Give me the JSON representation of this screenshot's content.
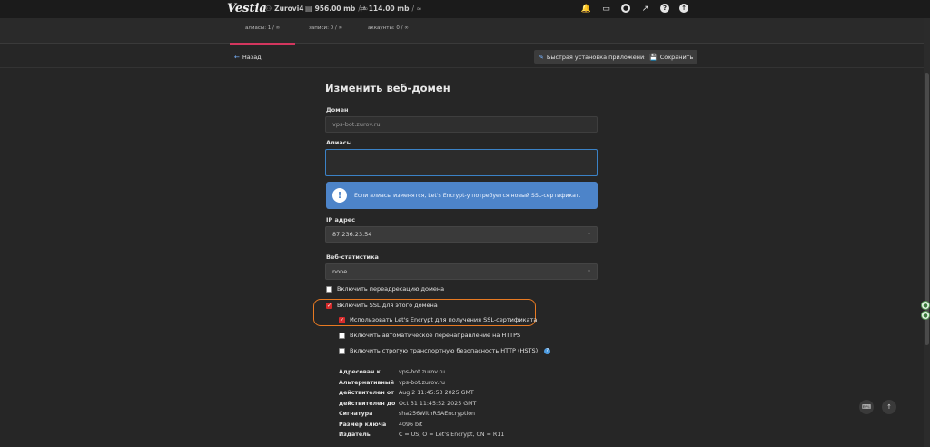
{
  "topbar": {
    "logo": "Vestia",
    "user": "Zurovi4",
    "disk": "956.00 mb",
    "disk_limit": "/ ∞",
    "bandwidth": "114.00 mb",
    "bandwidth_limit": "/ ∞"
  },
  "strip": {
    "aliases": "алиасы: 1 / ∞",
    "records": "записи: 0 / ∞",
    "accounts": "аккаунты: 0 / ∞"
  },
  "toolbar": {
    "back": "Назад",
    "quick_install": "Быстрая установка приложения",
    "save": "Сохранить"
  },
  "form": {
    "title": "Изменить веб-домен",
    "domain_label": "Домен",
    "domain_value": "vps-bot.zurov.ru",
    "aliases_label": "Алиасы",
    "alert": "Если алиасы изменятся, Let's Encrypt-у потребуется новый SSL-сертификат.",
    "ip_label": "IP адрес",
    "ip_value": "87.236.23.54",
    "stats_label": "Веб-статистика",
    "stats_value": "none",
    "redirect_label": "Включить переадресацию домена",
    "ssl_label": "Включить SSL для этого домена",
    "letsencrypt_label": "Использовать Let's Encrypt для получения SSL-сертификата",
    "https_label": "Включить автоматическое перенаправление на HTTPS",
    "hsts_label": "Включить строгую транспортную безопасность HTTP (HSTS)"
  },
  "cert": {
    "rows": [
      {
        "k": "Адресован к",
        "v": "vps-bot.zurov.ru"
      },
      {
        "k": "Альтернативный",
        "v": "vps-bot.zurov.ru"
      },
      {
        "k": "действителен от",
        "v": "Aug 2 11:45:53 2025 GMT"
      },
      {
        "k": "действителен до",
        "v": "Oct 31 11:45:52 2025 GMT"
      },
      {
        "k": "Сигнатура",
        "v": "sha256WithRSAEncryption"
      },
      {
        "k": "Размер ключа",
        "v": "4096 bit"
      },
      {
        "k": "Издатель",
        "v": "C = US, O = Let's Encrypt, CN = R11"
      }
    ]
  },
  "colors": {
    "accent": "#d3365e",
    "alert_bg": "#4d84c9",
    "highlight": "#e87a22",
    "checkbox_on": "#d62b2b"
  }
}
